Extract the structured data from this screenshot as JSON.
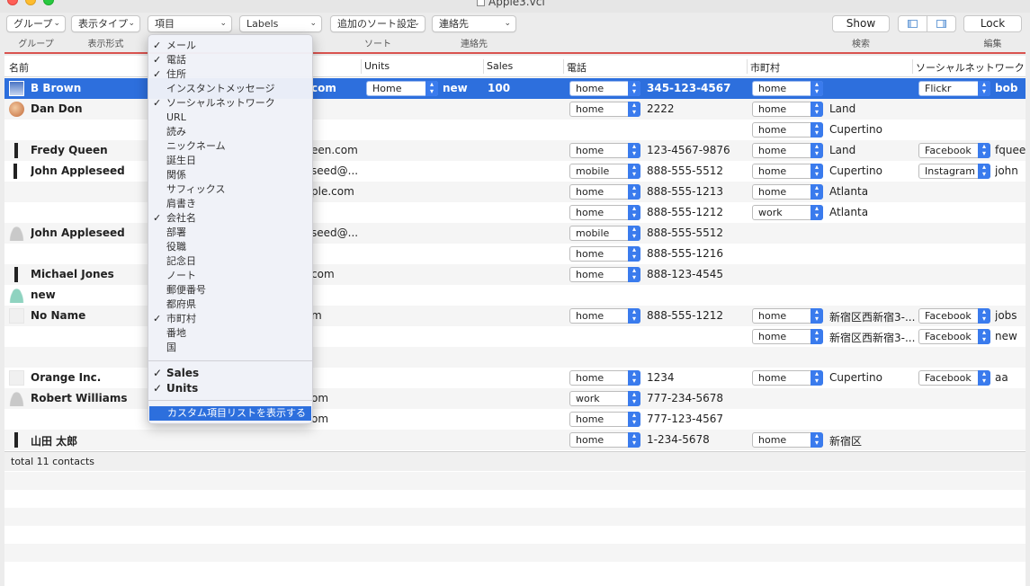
{
  "window": {
    "title": "Apple3.vcf"
  },
  "toolbar": {
    "group_popup": "グループ",
    "view_type_popup": "表示タイプ",
    "items_popup": "項目",
    "labels_popup": "Labels",
    "sort_popup": "追加のソート設定",
    "contacts_popup": "連絡先",
    "show_button": "Show",
    "lock_button": "Lock",
    "group_label": "グループ",
    "display_label": "表示形式",
    "sort_label": "ソート",
    "contacts_label": "連絡先",
    "search_label": "検索",
    "edit_label": "編集"
  },
  "columns": {
    "name": "名前",
    "units": "Units",
    "sales": "Sales",
    "phone": "電話",
    "city": "市町村",
    "social": "ソーシャルネットワーク"
  },
  "rows": [
    {
      "name": "B Brown",
      "email": "com",
      "units_popup": "Home",
      "units": "new",
      "sales": "100",
      "phone_label": "home",
      "phone": "345-123-4567",
      "city_label": "home",
      "city": "",
      "social_label": "Flickr",
      "social": "bob"
    },
    {
      "name": "Dan Don",
      "email": "",
      "phone_label": "home",
      "phone": "2222",
      "city_label": "home",
      "city": "Land"
    },
    {
      "name": "",
      "email": "",
      "city_label": "home",
      "city": "Cupertino"
    },
    {
      "name": "Fredy Queen",
      "email": "een.com",
      "phone_label": "home",
      "phone": "123-4567-9876",
      "city_label": "home",
      "city": "Land",
      "social_label": "Facebook",
      "social": "fqueen"
    },
    {
      "name": "John Appleseed",
      "email": "seed@...",
      "phone_label": "mobile",
      "phone": "888-555-5512",
      "city_label": "home",
      "city": "Cupertino",
      "social_label": "Instagram",
      "social": "john"
    },
    {
      "name": "",
      "email": "ple.com",
      "phone_label": "home",
      "phone": "888-555-1213",
      "city_label": "home",
      "city": "Atlanta"
    },
    {
      "name": "",
      "email": "",
      "phone_label": "home",
      "phone": "888-555-1212",
      "city_label": "work",
      "city": "Atlanta"
    },
    {
      "name": "John Appleseed",
      "email": "seed@...",
      "phone_label": "mobile",
      "phone": "888-555-5512"
    },
    {
      "name": "",
      "email": "",
      "phone_label": "home",
      "phone": "888-555-1216"
    },
    {
      "name": "Michael Jones",
      "email": "com",
      "phone_label": "home",
      "phone": "888-123-4545"
    },
    {
      "name": "new",
      "email": ""
    },
    {
      "name": "No Name",
      "email": "m",
      "phone_label": "home",
      "phone": "888-555-1212",
      "city_label": "home",
      "city": "新宿区西新宿3-...",
      "social_label": "Facebook",
      "social": "jobs"
    },
    {
      "name": "",
      "email": "",
      "city_label": "home",
      "city": "新宿区西新宿3-...",
      "social_label": "Facebook",
      "social": "new"
    },
    {
      "name": "",
      "email": ""
    },
    {
      "name": "Orange Inc.",
      "email": "",
      "phone_label": "home",
      "phone": "1234",
      "city_label": "home",
      "city": "Cupertino",
      "social_label": "Facebook",
      "social": "aa"
    },
    {
      "name": "Robert Williams",
      "email": "om",
      "phone_label": "work",
      "phone": "777-234-5678"
    },
    {
      "name": "",
      "email": "om",
      "phone_label": "home",
      "phone": "777-123-4567"
    },
    {
      "name": "山田 太郎",
      "email": "",
      "phone_label": "home",
      "phone": "1-234-5678",
      "city_label": "home",
      "city": "新宿区"
    }
  ],
  "footer": {
    "total": "total 11 contacts"
  },
  "menu": {
    "items": [
      {
        "label": "メール",
        "checked": true
      },
      {
        "label": "電話",
        "checked": true
      },
      {
        "label": "住所",
        "checked": true
      },
      {
        "label": "インスタントメッセージ",
        "checked": false
      },
      {
        "label": "ソーシャルネットワーク",
        "checked": true
      },
      {
        "label": "URL",
        "checked": false
      },
      {
        "label": "読み",
        "checked": false
      },
      {
        "label": "ニックネーム",
        "checked": false
      },
      {
        "label": "誕生日",
        "checked": false
      },
      {
        "label": "関係",
        "checked": false
      },
      {
        "label": "サフィックス",
        "checked": false
      },
      {
        "label": "肩書き",
        "checked": false
      },
      {
        "label": "会社名",
        "checked": true
      },
      {
        "label": "部署",
        "checked": false
      },
      {
        "label": "役職",
        "checked": false
      },
      {
        "label": "記念日",
        "checked": false
      },
      {
        "label": "ノート",
        "checked": false
      },
      {
        "label": "郵便番号",
        "checked": false
      },
      {
        "label": "都府県",
        "checked": false
      },
      {
        "label": "市町村",
        "checked": true
      },
      {
        "label": "番地",
        "checked": false
      },
      {
        "label": "国",
        "checked": false
      }
    ],
    "custom_items": [
      {
        "label": "Sales",
        "checked": true
      },
      {
        "label": "Units",
        "checked": true
      }
    ],
    "show_custom_list": "カスタム項目リストを表示する",
    "check_glyph": "✓"
  },
  "colors": {
    "selection": "#2d6fdd",
    "accent_line": "#d9534f",
    "stepper": "#3a7bed"
  }
}
